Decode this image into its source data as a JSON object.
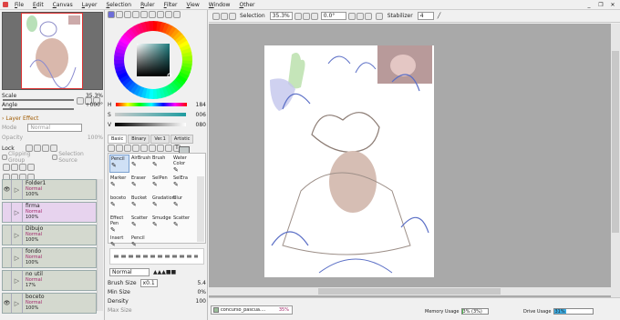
{
  "menu": [
    "File",
    "Edit",
    "Canvas",
    "Layer",
    "Selection",
    "Ruler",
    "Filter",
    "View",
    "Window",
    "Other"
  ],
  "window_controls": [
    "_",
    "❐",
    "✕"
  ],
  "navigator": {
    "scale_label": "Scale",
    "scale_value": "35.3%",
    "angle_label": "Angle",
    "angle_value": "+000°"
  },
  "layer_panel": {
    "effect_header": "Layer Effect",
    "mode_label": "Mode",
    "mode_value": "Normal",
    "opacity_label": "Opacity",
    "opacity_value": "100%",
    "lock_label": "Lock",
    "clipping_label": "Clipping Group",
    "selection_source_label": "Selection Source",
    "layers": [
      {
        "name": "Folder1",
        "mode": "Normal",
        "opacity": "100%",
        "visible": true,
        "selected": false
      },
      {
        "name": "firma",
        "mode": "Normal",
        "opacity": "100%",
        "visible": false,
        "selected": true
      },
      {
        "name": "Dibujo",
        "mode": "Normal",
        "opacity": "100%",
        "visible": false,
        "selected": false
      },
      {
        "name": "fondo",
        "mode": "Normal",
        "opacity": "100%",
        "visible": false,
        "selected": false
      },
      {
        "name": "no util",
        "mode": "Normal",
        "opacity": "17%",
        "visible": false,
        "selected": false
      },
      {
        "name": "boceto",
        "mode": "Normal",
        "opacity": "100%",
        "visible": true,
        "selected": false
      }
    ]
  },
  "color_panel": {
    "h_label": "H",
    "h_value": "184",
    "s_label": "S",
    "s_value": "006",
    "v_label": "V",
    "v_value": "080",
    "current_color": "#c5cbcb",
    "wheel_color": "#1e7d7f"
  },
  "tool_tabs": [
    "Basic",
    "Binary",
    "Ver.1",
    "Artistic"
  ],
  "tools": [
    {
      "name": "Pencil"
    },
    {
      "name": "AirBrush"
    },
    {
      "name": "Brush"
    },
    {
      "name": "Water Color"
    },
    {
      "name": "Marker"
    },
    {
      "name": "Eraser"
    },
    {
      "name": "SelPen"
    },
    {
      "name": "SelEra"
    },
    {
      "name": "boceto"
    },
    {
      "name": "Bucket"
    },
    {
      "name": "Gradation"
    },
    {
      "name": "Blur"
    },
    {
      "name": "Effect Pen"
    },
    {
      "name": "Scatter"
    },
    {
      "name": "Smudge"
    },
    {
      "name": "Scatter"
    },
    {
      "name": "Insert"
    },
    {
      "name": "Pencil"
    }
  ],
  "brush_settings": {
    "mode_value": "Normal",
    "brush_size_label": "Brush Size",
    "brush_size_mult": "x0.1",
    "brush_size_value": "5.4",
    "min_size_label": "Min Size",
    "min_size_value": "0%",
    "density_label": "Density",
    "density_value": "100",
    "max_size_label": "Max Size"
  },
  "toolbar": {
    "selection_label": "Selection",
    "zoom_value": "35.3%",
    "angle_value": "0.0°",
    "stabilizer_label": "Stabilizer",
    "stabilizer_value": "4"
  },
  "status": {
    "doc_name": "concurso_pascua....",
    "doc_zoom": "35%",
    "memory_label": "Memory Usage",
    "memory_value": "3% (3%)",
    "memory_fraction": 0.03,
    "drive_label": "Drive Usage",
    "drive_value": "31%",
    "drive_fraction": 0.31
  }
}
